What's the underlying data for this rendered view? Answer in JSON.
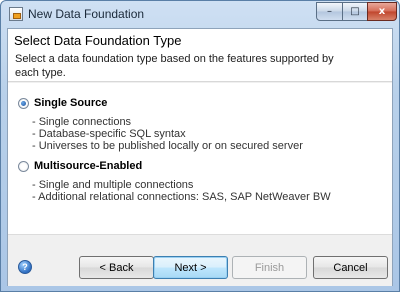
{
  "window": {
    "title": "New Data Foundation",
    "minimize_glyph": "–",
    "maximize_glyph": "□",
    "close_glyph": "x"
  },
  "header": {
    "title": "Select Data Foundation Type",
    "description": "Select a data foundation type based on the features supported by each type."
  },
  "options": [
    {
      "label": "Single Source",
      "selected": true,
      "details": [
        "- Single connections",
        "- Database-specific SQL syntax",
        "- Universes to be published locally or on secured server"
      ]
    },
    {
      "label": "Multisource-Enabled",
      "selected": false,
      "details": [
        "- Single and multiple connections",
        "- Additional relational connections: SAS, SAP NetWeaver BW"
      ]
    }
  ],
  "footer": {
    "help_glyph": "?",
    "back_label": "< Back",
    "next_label": "Next >",
    "finish_label": "Finish",
    "cancel_label": "Cancel"
  }
}
